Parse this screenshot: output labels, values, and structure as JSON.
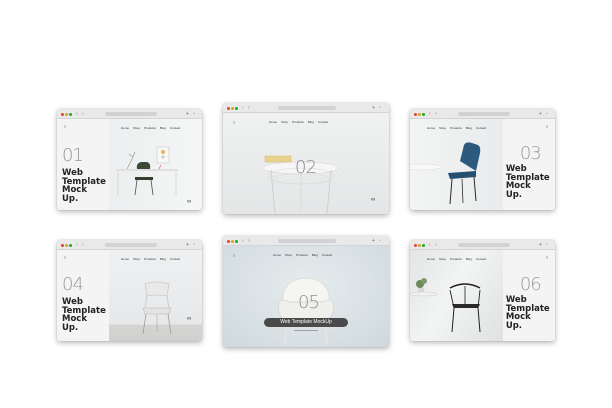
{
  "windows": [
    {
      "number": "01",
      "title": "Web\nTemplate\nMock\nUp.",
      "menu": [
        "Home",
        "Shop",
        "Products",
        "Blog",
        "Contact"
      ]
    },
    {
      "number": "02",
      "menu": [
        "Home",
        "Shop",
        "Products",
        "Blog",
        "Contact"
      ]
    },
    {
      "number": "03",
      "title": "Web\nTemplate\nMock\nUp.",
      "menu": [
        "Home",
        "Shop",
        "Products",
        "Blog",
        "Contact"
      ]
    },
    {
      "number": "04",
      "title": "Web\nTemplate\nMock\nUp.",
      "menu": [
        "Home",
        "Shop",
        "Products",
        "Blog",
        "Contact"
      ]
    },
    {
      "number": "05",
      "banner": "Web Template MockUp",
      "menu": [
        "Home",
        "Shop",
        "Products",
        "Blog",
        "Contact"
      ]
    },
    {
      "number": "06",
      "title": "Web\nTemplate\nMock\nUp.",
      "menu": [
        "Home",
        "Shop",
        "Products",
        "Blog",
        "Contact"
      ]
    }
  ],
  "icons": {
    "back": "back-arrow-icon",
    "forward": "forward-arrow-icon",
    "refresh": "refresh-icon",
    "new_tab": "new-tab-icon",
    "tabs": "tabs-icon",
    "logo": "infinity-logo-icon",
    "menu": "hamburger-menu-icon"
  },
  "colors": {
    "close": "#e0443e",
    "minimize": "#dea123",
    "maximize": "#1aab29",
    "chair_green": "#3a4a37",
    "chair_blue": "#2c5a7e",
    "banner_bg": "#4a4a4a"
  }
}
